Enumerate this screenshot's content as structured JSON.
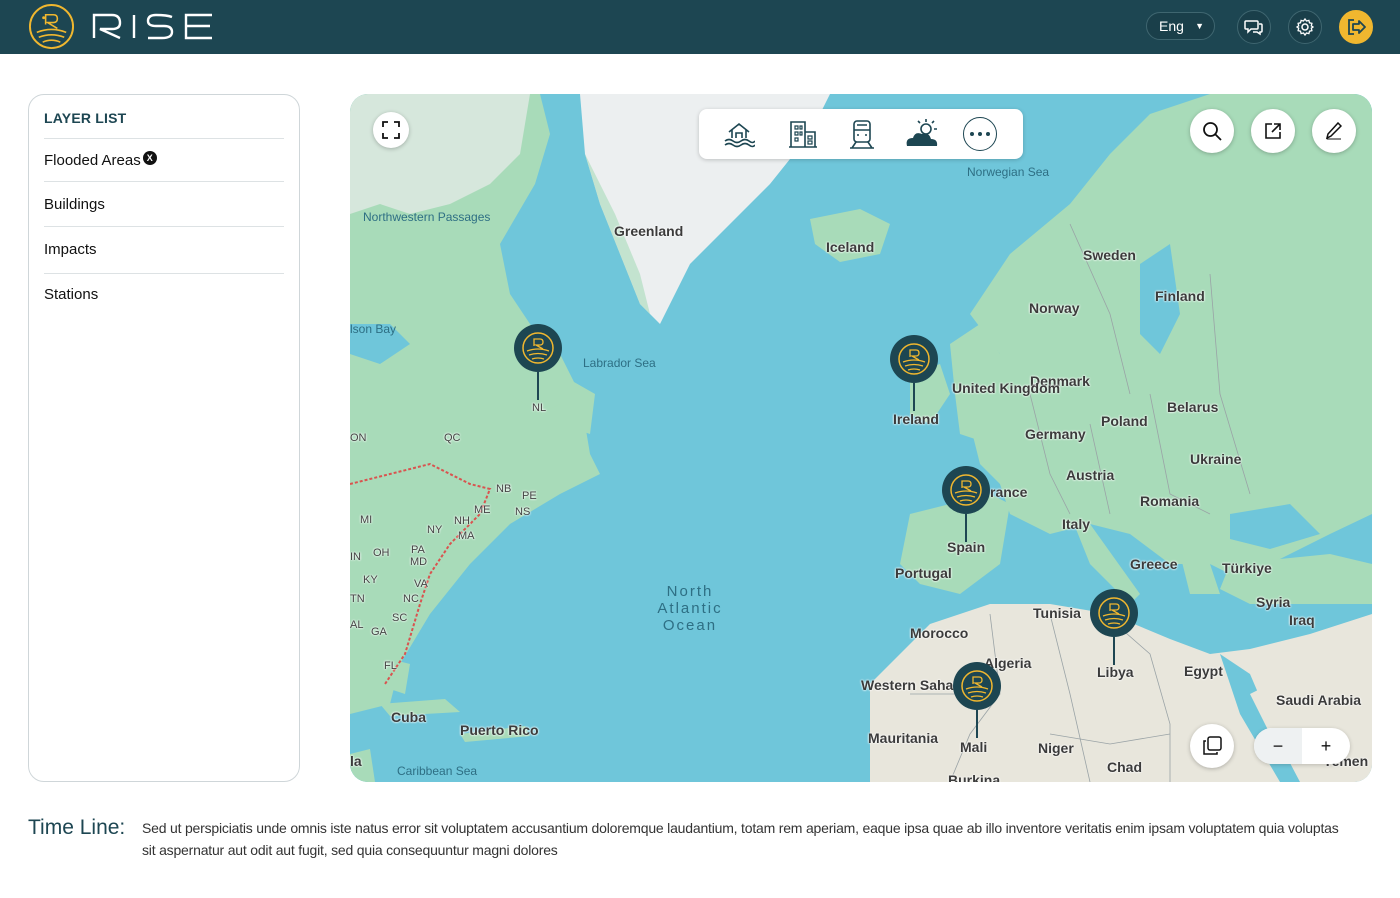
{
  "header": {
    "brand": "RISE",
    "language": "Eng",
    "icons": [
      "logo-icon",
      "chat-icon",
      "gear-icon",
      "logout-icon"
    ]
  },
  "layer_list": {
    "title": "LAYER LIST",
    "items": [
      {
        "label": "Flooded Areas",
        "active": true,
        "badge": "X"
      },
      {
        "label": "Buildings",
        "active": false
      },
      {
        "label": "Impacts",
        "active": false
      },
      {
        "label": "Stations",
        "active": false
      }
    ]
  },
  "map": {
    "toolbar": [
      "flood-icon",
      "building-icon",
      "train-icon",
      "weather-icon",
      "more-icon"
    ],
    "zoom": {
      "minus": "−",
      "plus": "+"
    },
    "places": {
      "greenland": "Greenland",
      "iceland": "Iceland",
      "sweden": "Sweden",
      "norway": "Norway",
      "finland": "Finland",
      "denmark": "Denmark",
      "uk": "United Kingdom",
      "ireland": "Ireland",
      "poland": "Poland",
      "belarus": "Belarus",
      "germany": "Germany",
      "ukraine": "Ukraine",
      "austria": "Austria",
      "romania": "Romania",
      "france": "rance",
      "italy": "Italy",
      "spain": "Spain",
      "portugal": "Portugal",
      "greece": "Greece",
      "turkiye": "Türkiye",
      "syria": "Syria",
      "iraq": "Iraq",
      "tunisia": "Tunisia",
      "morocco": "Morocco",
      "algeria": "Algeria",
      "libya": "Libya",
      "egypt": "Egypt",
      "saudi": "Saudi Arabia",
      "western_sahara": "Western Sahara",
      "mauritania": "Mauritania",
      "mali": "Mali",
      "niger": "Niger",
      "chad": "Chad",
      "burkina": "Burkina",
      "yemen": "Yemen",
      "cuba": "Cuba",
      "puerto_rico": "Puerto Rico",
      "la": "la",
      "nl": "NL",
      "qc": "QC",
      "on": "ON",
      "nb": "NB",
      "pe": "PE",
      "ns": "NS",
      "me": "ME",
      "nh": "NH",
      "ma": "MA",
      "ny": "NY",
      "mi": "MI",
      "oh": "OH",
      "in": "IN",
      "pa": "PA",
      "md": "MD",
      "ky": "KY",
      "va": "VA",
      "tn": "TN",
      "nc": "NC",
      "sc": "SC",
      "ga": "GA",
      "al": "AL",
      "fl": "FL"
    },
    "waters": {
      "norwegian_sea": "Norwegian Sea",
      "nw_passages": "Northwestern Passages",
      "hudson": "lson Bay",
      "labrador": "Labrador Sea",
      "caribbean": "Caribbean Sea",
      "atlantic": "North Atlantic Ocean"
    },
    "colors": {
      "ocean": "#6fc6da",
      "land": "#a8dbb9",
      "ice": "#eceff0",
      "desert": "#e8e6dc",
      "pin": "#1d4652",
      "accent": "#f0b72f"
    }
  },
  "timeline": {
    "label": "Time Line:",
    "text": "Sed ut perspiciatis unde omnis iste natus error sit voluptatem accusantium doloremque laudantium, totam rem aperiam, eaque ipsa quae ab illo inventore veritatis enim ipsam voluptatem quia voluptas sit aspernatur aut odit aut fugit, sed quia consequuntur magni dolores"
  }
}
